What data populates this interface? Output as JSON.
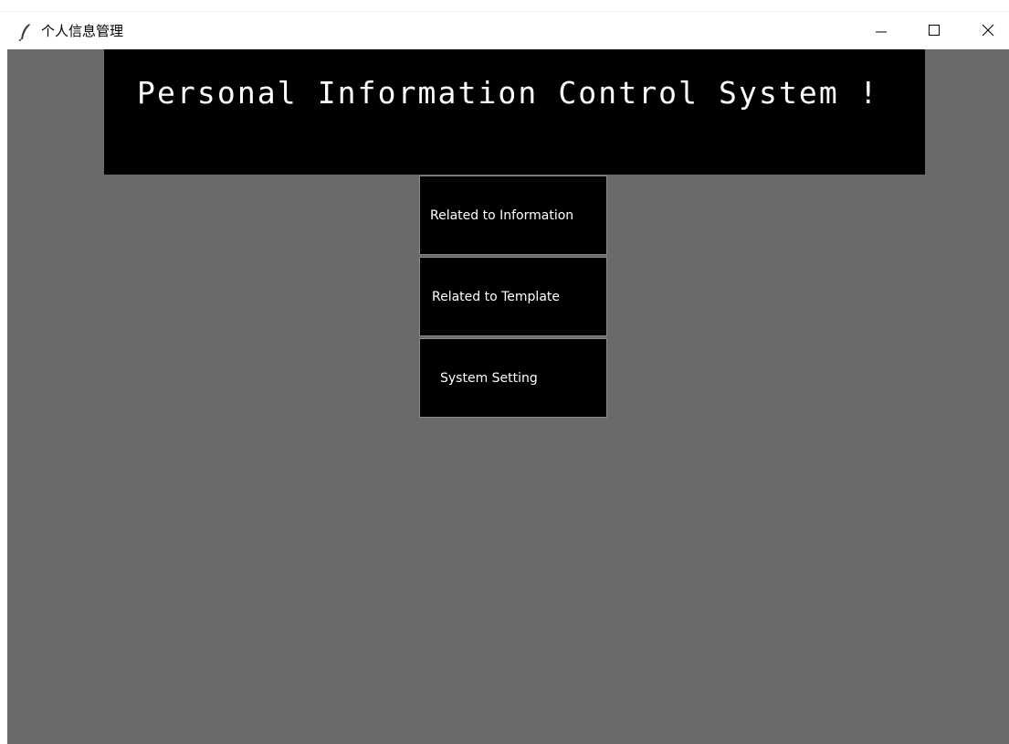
{
  "window": {
    "title": "个人信息管理",
    "icon": "feather-icon",
    "controls": [
      "minimize-icon",
      "maximize-icon",
      "close-icon"
    ]
  },
  "banner": {
    "text": "Personal Information Control System !"
  },
  "menu": {
    "items": [
      {
        "label": "Related to Information"
      },
      {
        "label": "Related to Template"
      },
      {
        "label": "System Setting"
      }
    ]
  },
  "colors": {
    "background": "#6a6a6a",
    "banner": "#000000",
    "button": "#000000",
    "text": "#ffffff"
  }
}
